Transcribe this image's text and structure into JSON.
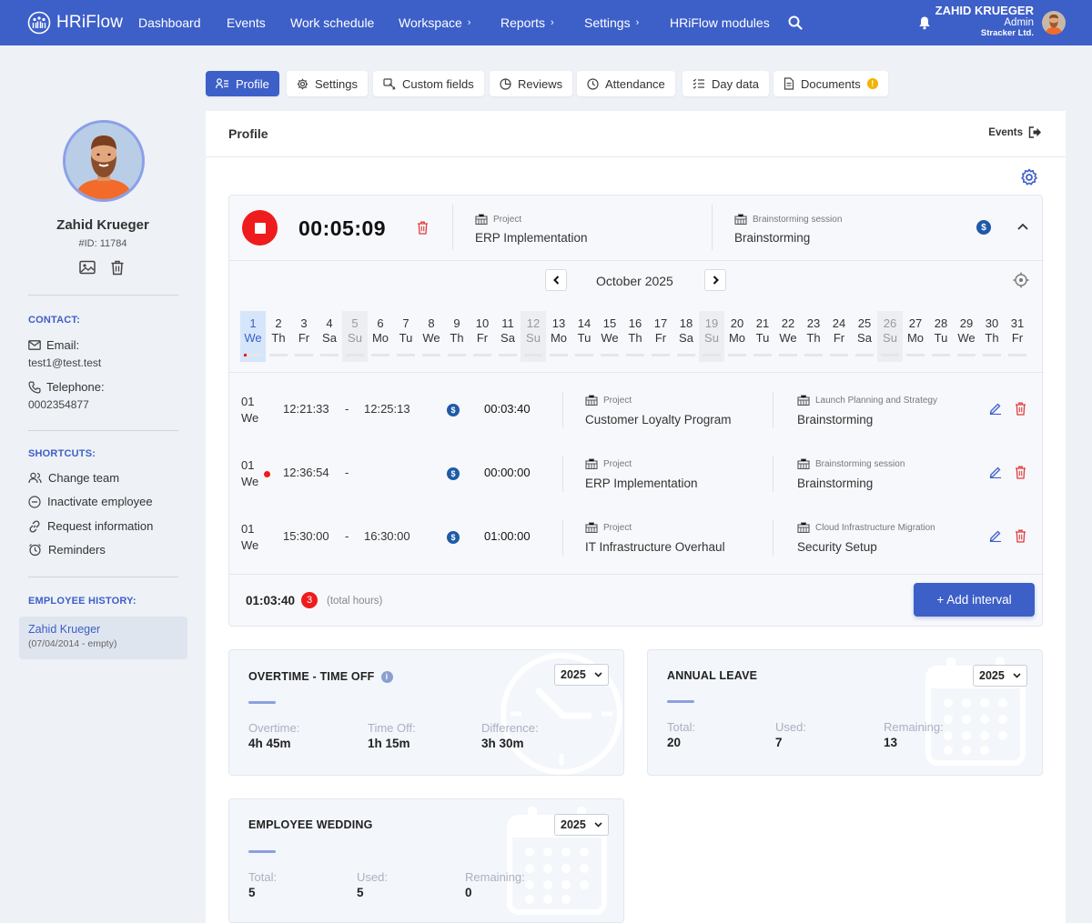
{
  "app": {
    "brand": "HRiFlow"
  },
  "nav": {
    "items": [
      {
        "label": "Dashboard"
      },
      {
        "label": "Events"
      },
      {
        "label": "Work schedule"
      },
      {
        "label": "Workspace"
      },
      {
        "label": "Reports"
      },
      {
        "label": "Settings"
      },
      {
        "label": "HRiFlow modules"
      }
    ],
    "chevron": "›",
    "user": {
      "name": "ZAHID KRUEGER",
      "role": "Admin",
      "company": "Stracker Ltd."
    }
  },
  "tabs": [
    {
      "label": "Profile",
      "icon": "user-list-icon"
    },
    {
      "label": "Settings",
      "icon": "gear-icon"
    },
    {
      "label": "Custom fields",
      "icon": "edit-field-icon"
    },
    {
      "label": "Reviews",
      "icon": "pie-chart-icon"
    },
    {
      "label": "Attendance",
      "icon": "clock-icon"
    },
    {
      "label": "Day data",
      "icon": "list-check-icon"
    },
    {
      "label": "Documents",
      "icon": "document-icon",
      "badge": "!"
    }
  ],
  "sidebar": {
    "name": "Zahid Krueger",
    "id": "#ID: 11784",
    "contact_heading": "CONTACT:",
    "email_label": "Email:",
    "email": "test1@test.test",
    "phone_label": "Telephone:",
    "phone": "0002354877",
    "shortcuts_heading": "SHORTCUTS:",
    "shortcuts": [
      {
        "label": "Change team",
        "icon": "users-icon"
      },
      {
        "label": "Inactivate employee",
        "icon": "minus-circle-icon"
      },
      {
        "label": "Request information",
        "icon": "link-icon"
      },
      {
        "label": "Reminders",
        "icon": "alarm-clock-icon"
      }
    ],
    "history_heading": "EMPLOYEE HISTORY:",
    "history": {
      "name": "Zahid Krueger",
      "range": "(07/04/2014 - empty)"
    }
  },
  "profile": {
    "title": "Profile",
    "events_link": "Events"
  },
  "timer": {
    "value": "00:05:09",
    "project_label": "Project",
    "project": "ERP Implementation",
    "task_label": "Brainstorming session",
    "task": "Brainstorming"
  },
  "calendar": {
    "month": "October 2025",
    "days": [
      {
        "n": "1",
        "w": "We"
      },
      {
        "n": "2",
        "w": "Th"
      },
      {
        "n": "3",
        "w": "Fr"
      },
      {
        "n": "4",
        "w": "Sa"
      },
      {
        "n": "5",
        "w": "Su"
      },
      {
        "n": "6",
        "w": "Mo"
      },
      {
        "n": "7",
        "w": "Tu"
      },
      {
        "n": "8",
        "w": "We"
      },
      {
        "n": "9",
        "w": "Th"
      },
      {
        "n": "10",
        "w": "Fr"
      },
      {
        "n": "11",
        "w": "Sa"
      },
      {
        "n": "12",
        "w": "Su"
      },
      {
        "n": "13",
        "w": "Mo"
      },
      {
        "n": "14",
        "w": "Tu"
      },
      {
        "n": "15",
        "w": "We"
      },
      {
        "n": "16",
        "w": "Th"
      },
      {
        "n": "17",
        "w": "Fr"
      },
      {
        "n": "18",
        "w": "Sa"
      },
      {
        "n": "19",
        "w": "Su"
      },
      {
        "n": "20",
        "w": "Mo"
      },
      {
        "n": "21",
        "w": "Tu"
      },
      {
        "n": "22",
        "w": "We"
      },
      {
        "n": "23",
        "w": "Th"
      },
      {
        "n": "24",
        "w": "Fr"
      },
      {
        "n": "25",
        "w": "Sa"
      },
      {
        "n": "26",
        "w": "Su"
      },
      {
        "n": "27",
        "w": "Mo"
      },
      {
        "n": "28",
        "w": "Tu"
      },
      {
        "n": "29",
        "w": "We"
      },
      {
        "n": "30",
        "w": "Th"
      },
      {
        "n": "31",
        "w": "Fr"
      }
    ]
  },
  "intervals": [
    {
      "day": "01",
      "weekday": "We",
      "start": "12:21:33",
      "sep": "-",
      "end": "12:25:13",
      "duration": "00:03:40",
      "project_label": "Project",
      "project": "Customer Loyalty Program",
      "task_label": "Launch Planning and Strategy",
      "task": "Brainstorming"
    },
    {
      "day": "01",
      "weekday": "We",
      "start": "12:36:54",
      "sep": "-",
      "end": "",
      "duration": "00:00:00",
      "project_label": "Project",
      "project": "ERP Implementation",
      "task_label": "Brainstorming session",
      "task": "Brainstorming"
    },
    {
      "day": "01",
      "weekday": "We",
      "start": "15:30:00",
      "sep": "-",
      "end": "16:30:00",
      "duration": "01:00:00",
      "project_label": "Project",
      "project": "IT Infrastructure Overhaul",
      "task_label": "Cloud Infrastructure Migration",
      "task": "Security Setup"
    }
  ],
  "totals": {
    "value": "01:03:40",
    "count": "3",
    "note": "(total hours)",
    "add_label": "+ Add interval"
  },
  "overtime": {
    "title": "OVERTIME - TIME OFF",
    "year": "2025",
    "labels": [
      "Overtime:",
      "Time Off:",
      "Difference:"
    ],
    "values": [
      "4h 45m",
      "1h 15m",
      "3h 30m"
    ]
  },
  "annual_leave": {
    "title": "ANNUAL LEAVE",
    "year": "2025",
    "labels": [
      "Total:",
      "Used:",
      "Remaining:"
    ],
    "values": [
      "20",
      "7",
      "13"
    ]
  },
  "wedding": {
    "title": "EMPLOYEE WEDDING",
    "year": "2025",
    "labels": [
      "Total:",
      "Used:",
      "Remaining:"
    ],
    "values": [
      "5",
      "5",
      "0"
    ]
  }
}
